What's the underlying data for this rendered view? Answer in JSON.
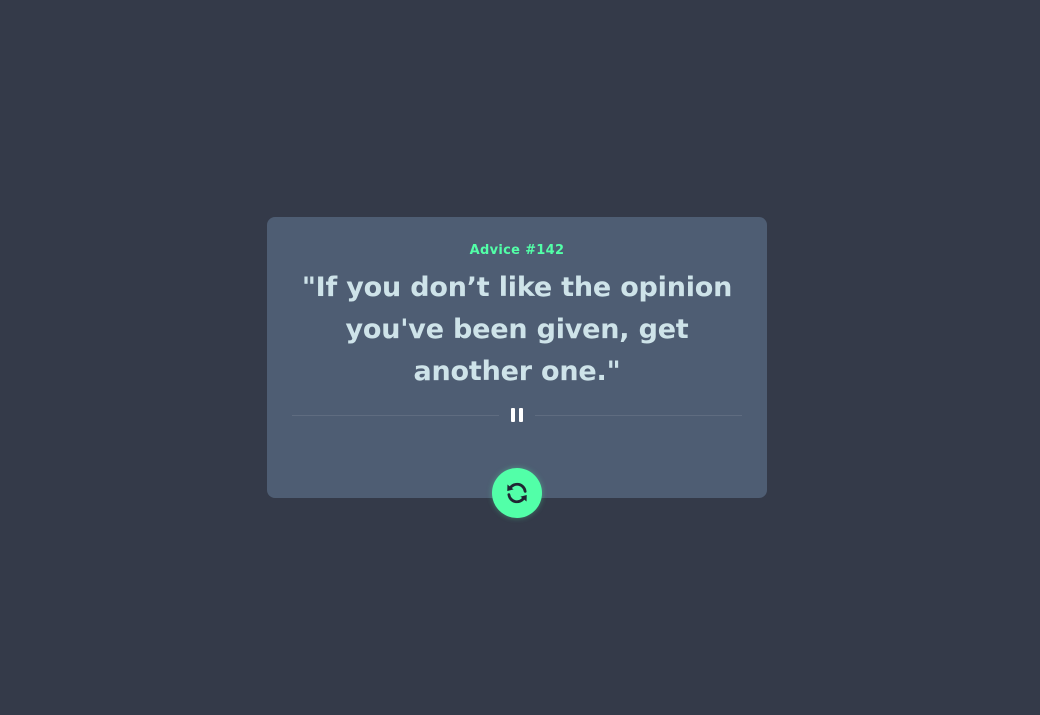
{
  "advice": {
    "label": "Advice #142",
    "quote": "\"If you don’t like the opinion you've been given, get another one.\""
  },
  "icons": {
    "divider": "pause-icon",
    "button": "refresh-icon"
  },
  "colors": {
    "background": "#343a49",
    "card": "#4e5d73",
    "accent": "#52ffa8",
    "text": "#cee3e9"
  }
}
